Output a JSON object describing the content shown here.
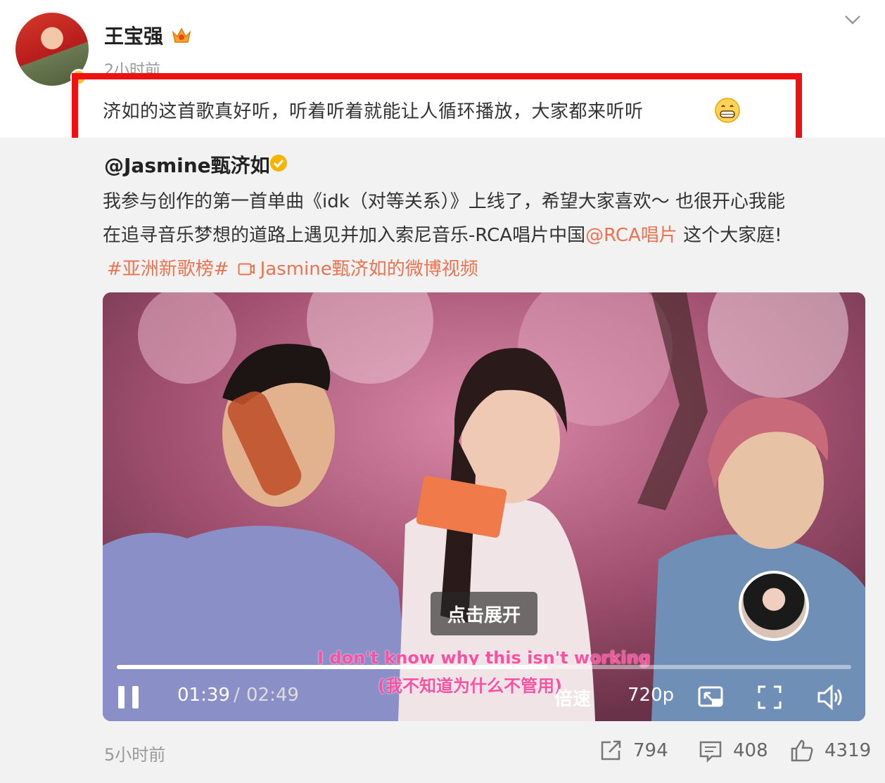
{
  "post": {
    "author": "王宝强",
    "time": "2小时前",
    "text": "济如的这首歌真好听，听着听着就能让人循环播放，大家都来听听"
  },
  "repost": {
    "author": "@Jasmine甄济如",
    "line1": "我参与创作的第一首单曲《idk（对等关系）》上线了，希望大家喜欢～ 也很开心我能",
    "line2_prefix": "在追寻音乐梦想的道路上遇见并加入索尼音乐-RCA唱片中国",
    "line2_link": "@RCA唱片",
    "line2_suffix": " 这个大家庭!",
    "hashtag": "#亚洲新歌榜#",
    "video_link": "Jasmine甄济如的微博视频"
  },
  "video": {
    "expand_label": "点击展开",
    "subtitle_en": "I don't know why this isn't working",
    "subtitle_zh": "(我不知道为什么不管用)",
    "time_current": "01:39",
    "time_separator": "/",
    "time_total": "02:49",
    "progress": 0.586,
    "speed_label": "倍速",
    "quality_label": "720p"
  },
  "footer": {
    "time": "5小时前",
    "reposts": "794",
    "comments": "408",
    "likes": "4319"
  },
  "colors": {
    "highlight_border": "#ee1111",
    "link": "#eb7350",
    "subtitle": "#ff4fa0"
  }
}
